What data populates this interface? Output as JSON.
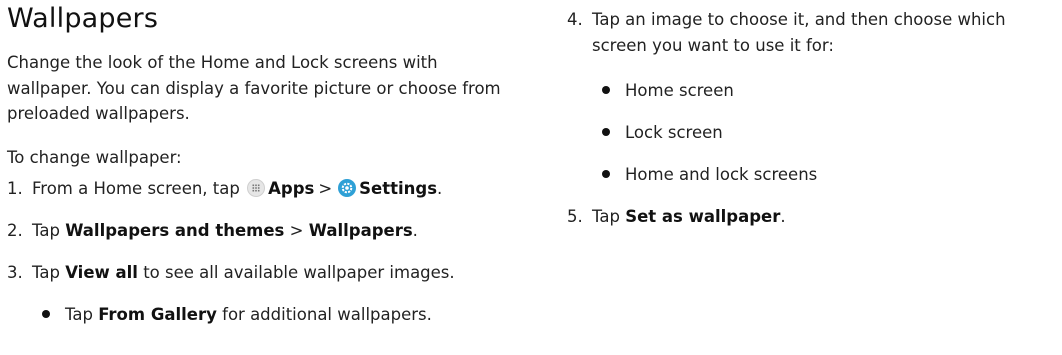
{
  "title": "Wallpapers",
  "intro": "Change the look of the Home and Lock screens with wallpaper. You can display a favorite picture or choose from preloaded wallpapers.",
  "lead": "To change wallpaper:",
  "steps": {
    "s1": {
      "num": "1.",
      "pre": "From a Home screen, tap",
      "apps": "Apps",
      "sep": ">",
      "settings": "Settings",
      "post": "."
    },
    "s2": {
      "num": "2.",
      "pre": "Tap",
      "b1": "Wallpapers and themes",
      "sep": ">",
      "b2": "Wallpapers",
      "post": "."
    },
    "s3": {
      "num": "3.",
      "pre": "Tap",
      "b1": "View all",
      "post": "to see all available wallpaper images."
    },
    "s3_bullet": {
      "pre": "Tap",
      "b1": "From Gallery",
      "post": "for additional wallpapers."
    },
    "s4": {
      "num": "4.",
      "text": "Tap an image to choose it, and then choose which screen you want to use it for:"
    },
    "s4_bullets": [
      "Home screen",
      "Lock screen",
      "Home and lock screens"
    ],
    "s5": {
      "num": "5.",
      "pre": "Tap",
      "b1": "Set as wallpaper",
      "post": "."
    }
  },
  "icons": {
    "apps": "apps-grid-icon",
    "settings": "settings-gear-icon"
  },
  "colors": {
    "settings_icon": "#2ea0d6",
    "text": "#222222"
  }
}
